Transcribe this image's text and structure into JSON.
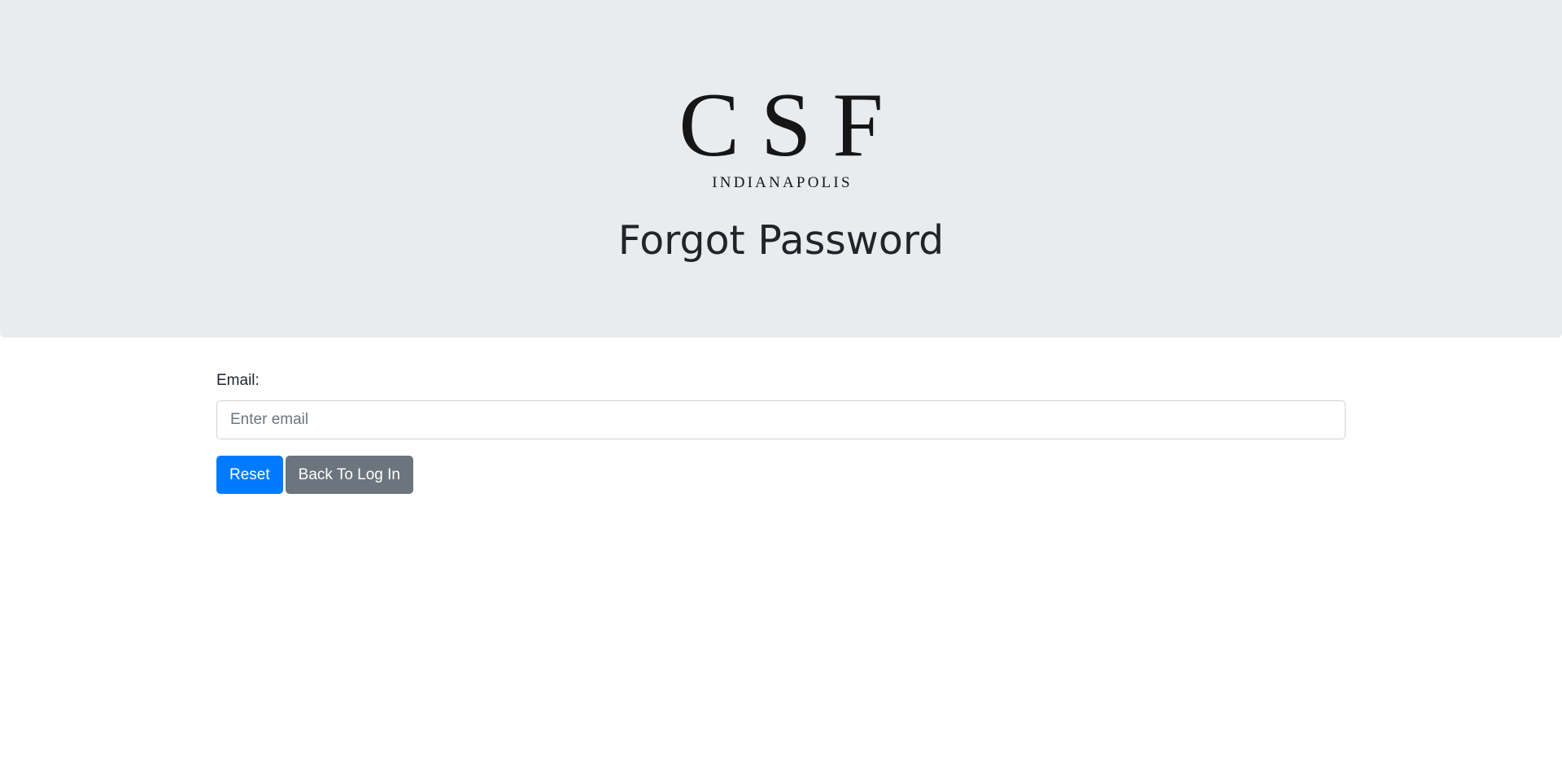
{
  "logo": {
    "mark": "CSF",
    "subtitle": "INDIANAPOLIS"
  },
  "header": {
    "title": "Forgot Password"
  },
  "form": {
    "email_label": "Email:",
    "email_placeholder": "Enter email",
    "email_value": ""
  },
  "actions": {
    "reset_label": "Reset",
    "back_label": "Back To Log In"
  },
  "colors": {
    "header_background": "#e9ecef",
    "primary_button": "#007bff",
    "secondary_button": "#6c757d"
  }
}
